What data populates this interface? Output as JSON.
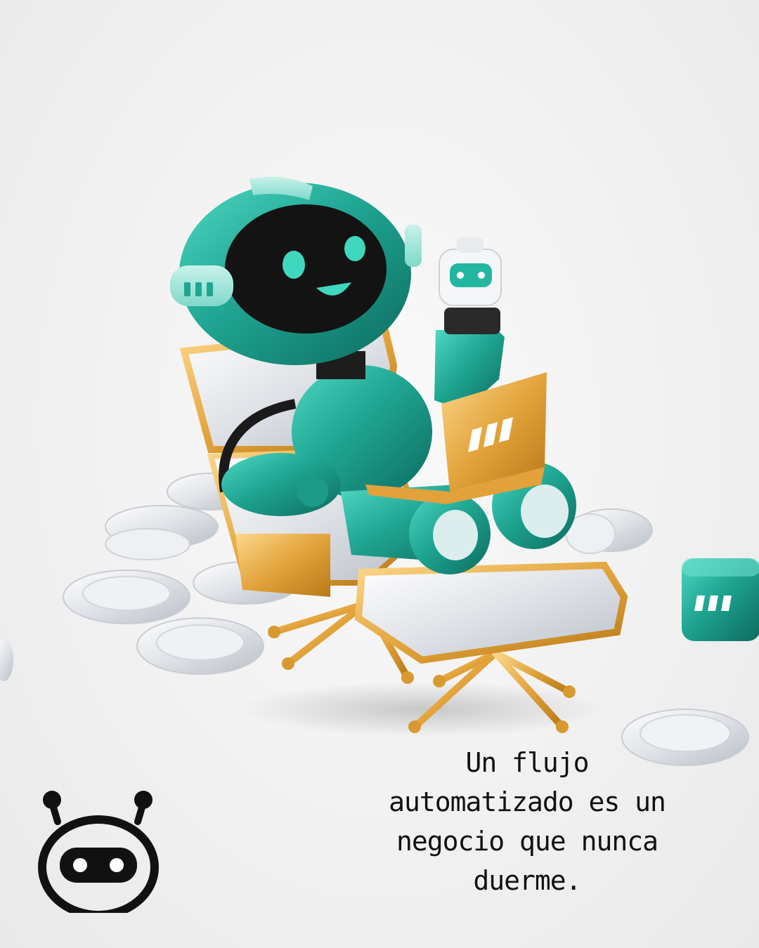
{
  "caption": {
    "lines": [
      "Un flujo",
      "automatizado es un",
      "negocio que nunca",
      "duerme."
    ]
  },
  "colors": {
    "background": "#efefef",
    "robot_teal": "#21a894",
    "gold": "#e3a43c",
    "silver": "#e4e6ea",
    "logo": "#111111"
  },
  "icons": [
    "robot-mascot-illustration",
    "mini-robot-figurine",
    "laptop",
    "coin",
    "brand-cube",
    "robot-head-logo"
  ]
}
